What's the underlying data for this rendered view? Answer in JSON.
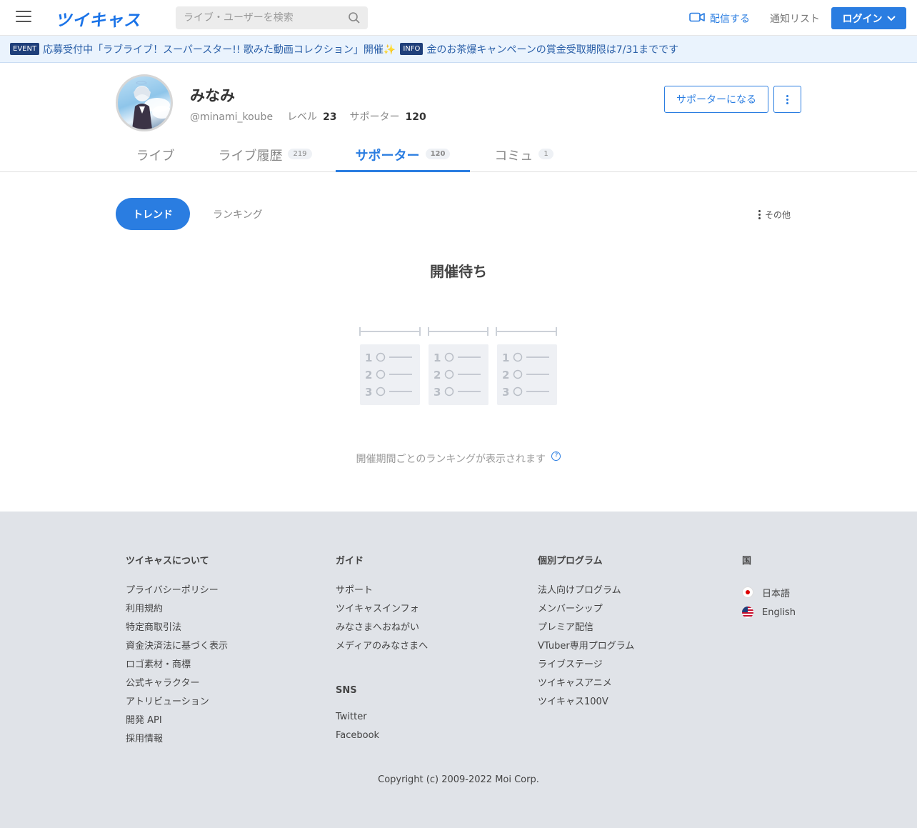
{
  "header": {
    "logo": "ツイキャス",
    "search_placeholder": "ライブ・ユーザーを検索",
    "broadcast_label": "配信する",
    "notify_label": "通知リスト",
    "login_label": "ログイン"
  },
  "ticker": {
    "items": [
      {
        "tag": "EVENT",
        "text": "応募受付中「ラブライブ！スーパースター!! 歌みた動画コレクション」開催✨"
      },
      {
        "tag": "INFO",
        "text": "金のお茶爆キャンペーンの賞金受取期限は7/31までです"
      }
    ]
  },
  "profile": {
    "name": "みなみ",
    "handle": "@minami_koube",
    "level_label": "レベル",
    "level": "23",
    "supporter_label": "サポーター",
    "supporter_count": "120",
    "become_supporter_label": "サポーターになる"
  },
  "tabs": [
    {
      "label": "ライブ",
      "count": ""
    },
    {
      "label": "ライブ履歴",
      "count": "219"
    },
    {
      "label": "サポーター",
      "count": "120"
    },
    {
      "label": "コミュ",
      "count": "1"
    }
  ],
  "subtabs": {
    "trend": "トレンド",
    "ranking": "ランキング",
    "other": "その他"
  },
  "main": {
    "waiting_title": "開催待ち",
    "rank_numbers": [
      "1",
      "2",
      "3"
    ],
    "description": "開催期間ごとのランキングが表示されます",
    "help_glyph": "?"
  },
  "footer": {
    "about": {
      "title": "ツイキャスについて",
      "links": [
        "プライバシーポリシー",
        "利用規約",
        "特定商取引法",
        "資金決済法に基づく表示",
        "ロゴ素材・商標",
        "公式キャラクター",
        "アトリビューション",
        "開発 API",
        "採用情報"
      ]
    },
    "guide": {
      "title": "ガイド",
      "links": [
        "サポート",
        "ツイキャスインフォ",
        "みなさまへおねがい",
        "メディアのみなさまへ"
      ]
    },
    "sns": {
      "title": "SNS",
      "links": [
        "Twitter",
        "Facebook"
      ]
    },
    "programs": {
      "title": "個別プログラム",
      "links": [
        "法人向けプログラム",
        "メンバーシップ",
        "プレミア配信",
        "VTuber専用プログラム",
        "ライブステージ",
        "ツイキャスアニメ",
        "ツイキャス100V"
      ]
    },
    "country": {
      "title": "国",
      "languages": [
        "日本語",
        "English"
      ]
    },
    "copyright": "Copyright (c) 2009-2022 Moi Corp."
  },
  "colors": {
    "accent": "#2a7de1",
    "footer_bg": "#e0e3e8",
    "ticker_bg": "#eaf3fd"
  }
}
